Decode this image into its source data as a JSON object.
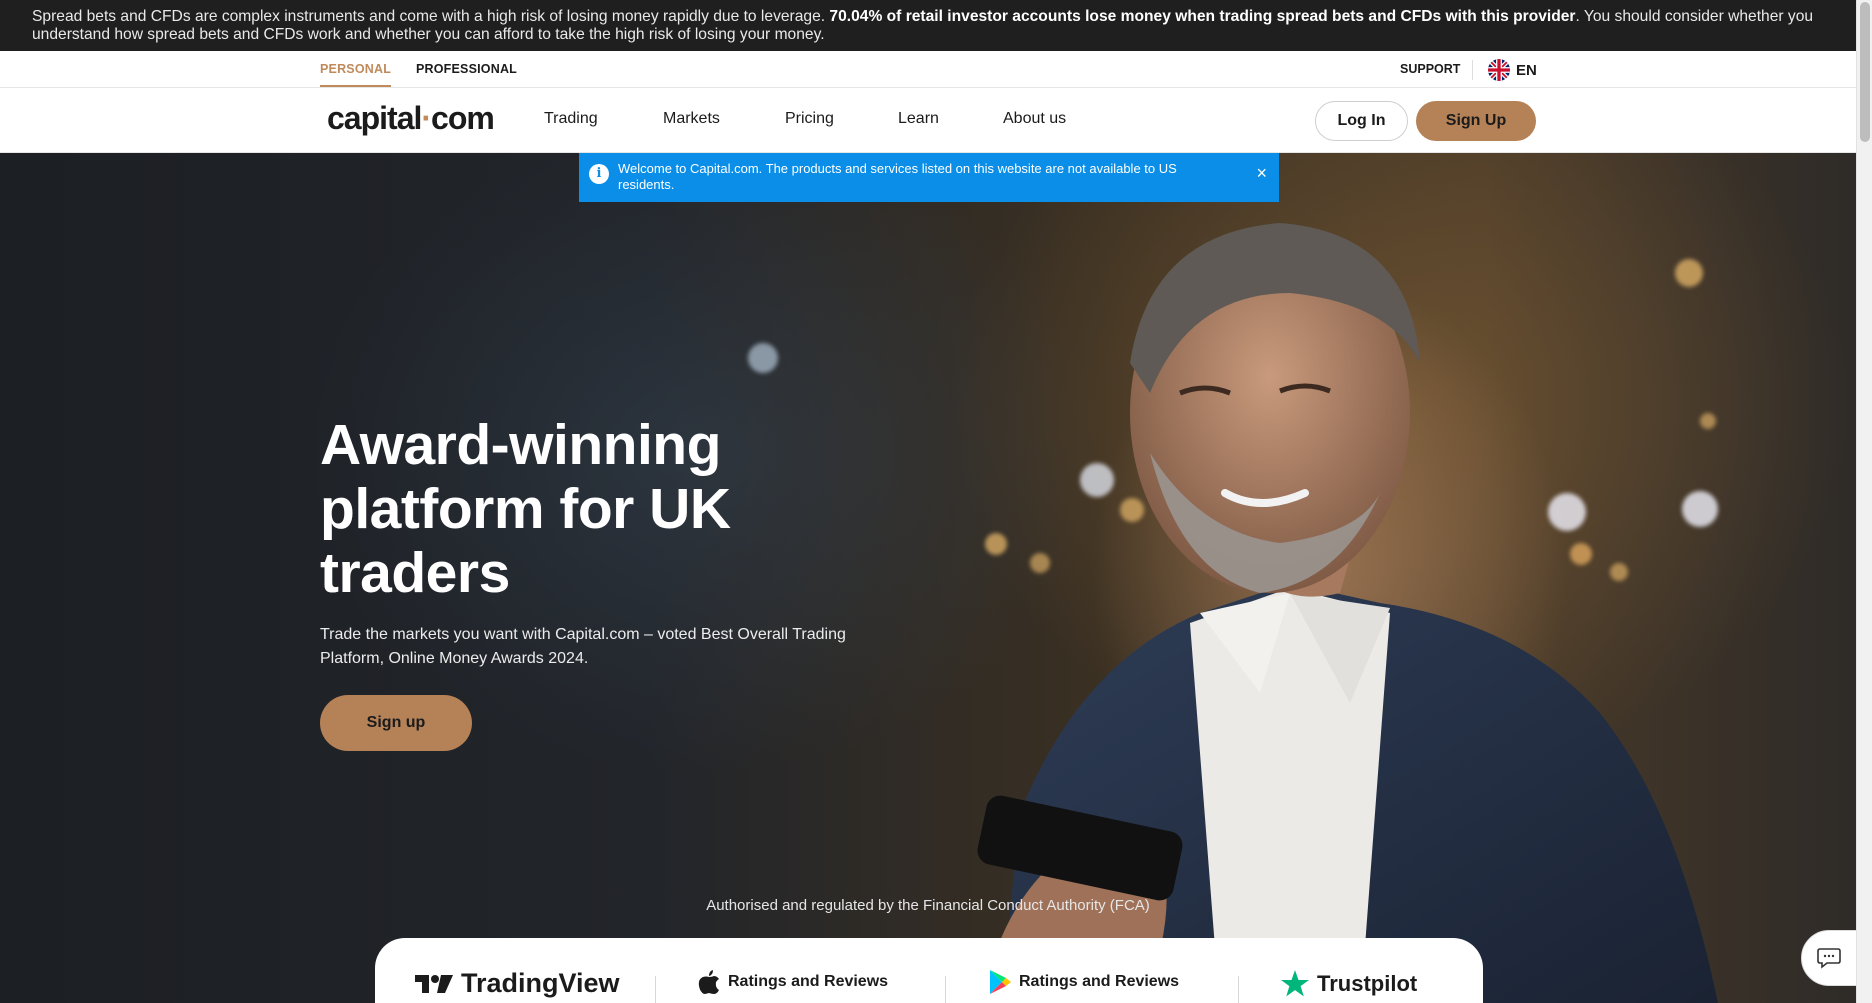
{
  "risk_banner": {
    "text_before": "Spread bets and CFDs are complex instruments and come with a high risk of losing money rapidly due to leverage. ",
    "bold": "70.04% of retail investor accounts lose money when trading spread bets and CFDs with this provider",
    "text_after": ". You should consider whether you understand how spread bets and CFDs work and whether you can afford to take the high risk of losing your money."
  },
  "topstrip": {
    "personal": "PERSONAL",
    "professional": "PROFESSIONAL",
    "support": "SUPPORT",
    "language": "EN"
  },
  "nav": {
    "logo_left": "capital",
    "logo_dot": "·",
    "logo_right": "com",
    "items": [
      "Trading",
      "Markets",
      "Pricing",
      "Learn",
      "About us"
    ],
    "login": "Log In",
    "signup": "Sign Up"
  },
  "notice": {
    "text": "Welcome to Capital.com. The products and services listed on this website are not available to US residents.",
    "close": "×"
  },
  "hero": {
    "title": "Award-winning platform for UK traders",
    "subtitle": "Trade the markets you want with Capital.com – voted Best Overall Trading Platform, Online Money Awards 2024.",
    "cta": "Sign up",
    "regulated": "Authorised and regulated by the Financial Conduct Authority (FCA)"
  },
  "ratings": {
    "tradingview": "TradingView",
    "apple": "Ratings and Reviews",
    "google": "Ratings and Reviews",
    "trustpilot": "Trustpilot"
  },
  "colors": {
    "accent": "#b58157",
    "notice": "#0a8ee8",
    "banner": "#1f1f1f"
  },
  "icons": {
    "info": "info-icon",
    "close": "close-icon",
    "flag": "uk-flag-icon",
    "apple": "apple-icon",
    "google_play": "google-play-icon",
    "trustpilot_star": "trustpilot-star-icon",
    "chat": "chat-icon"
  }
}
